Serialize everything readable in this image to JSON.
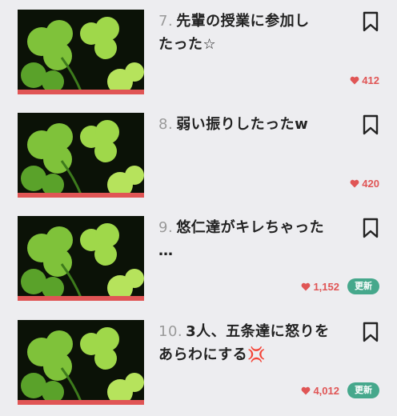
{
  "items": [
    {
      "number": "7.",
      "title_line1": "先輩の授業に参加し",
      "title_line2": "たった☆",
      "likes": "412",
      "badge": "",
      "thumbnail_icon": "clover-image",
      "bookmark_icon": "bookmark-icon",
      "heart_icon": "heart-icon"
    },
    {
      "number": "8.",
      "title_line1": "弱い振りしたったw",
      "title_line2": "",
      "likes": "420",
      "badge": "",
      "thumbnail_icon": "clover-image",
      "bookmark_icon": "bookmark-icon",
      "heart_icon": "heart-icon"
    },
    {
      "number": "9.",
      "title_line1": "悠仁達がキレちゃった",
      "title_line2": "…",
      "likes": "1,152",
      "badge": "更新",
      "thumbnail_icon": "clover-image",
      "bookmark_icon": "bookmark-icon",
      "heart_icon": "heart-icon"
    },
    {
      "number": "10.",
      "title_line1": "3人、五条達に怒りを",
      "title_line2": "あらわにする",
      "emoji": "💢",
      "likes": "4,012",
      "badge": "更新",
      "thumbnail_icon": "clover-image",
      "bookmark_icon": "bookmark-icon",
      "heart_icon": "heart-icon"
    }
  ],
  "colors": {
    "background": "#ededf0",
    "accent_red": "#e05555",
    "badge_green": "#46a88c",
    "title": "#222222",
    "number_gray": "#9a9a9a"
  }
}
